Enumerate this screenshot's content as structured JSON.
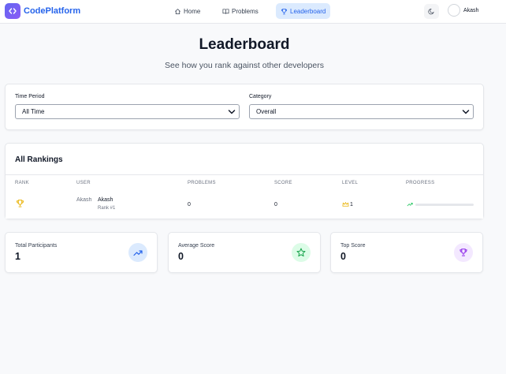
{
  "brand": {
    "name": "CodePlatform"
  },
  "nav": {
    "items": [
      {
        "label": "Home",
        "icon": "home-icon"
      },
      {
        "label": "Problems",
        "icon": "book-icon"
      },
      {
        "label": "Leaderboard",
        "icon": "trophy-icon",
        "active": true
      }
    ]
  },
  "user": {
    "name": "Akash",
    "avatar_alt": ""
  },
  "page": {
    "title": "Leaderboard",
    "subtitle": "See how you rank against other developers"
  },
  "filters": {
    "time_period": {
      "label": "Time Period",
      "value": "All Time"
    },
    "category": {
      "label": "Category",
      "value": "Overall"
    }
  },
  "rankings": {
    "title": "All Rankings",
    "columns": [
      "RANK",
      "USER",
      "PROBLEMS",
      "SCORE",
      "LEVEL",
      "PROGRESS"
    ],
    "rows": [
      {
        "user_avatar_alt": "Akash",
        "user": "Akash",
        "rank_label": "Rank #1",
        "problems": "0",
        "score": "0",
        "level": "1",
        "progress": 0
      }
    ]
  },
  "stats": [
    {
      "label": "Total Participants",
      "value": "1",
      "icon": "trending-up-icon"
    },
    {
      "label": "Average Score",
      "value": "0",
      "icon": "star-icon"
    },
    {
      "label": "Top Score",
      "value": "0",
      "icon": "trophy-icon"
    }
  ],
  "colors": {
    "accent": "#2563eb",
    "nav_active_bg": "#dbeafe",
    "trophy_gold": "#eab308",
    "stat_blue_bg": "#dbeafe",
    "stat_green_bg": "#dcfce7",
    "stat_purple_bg": "#f3e8ff"
  }
}
